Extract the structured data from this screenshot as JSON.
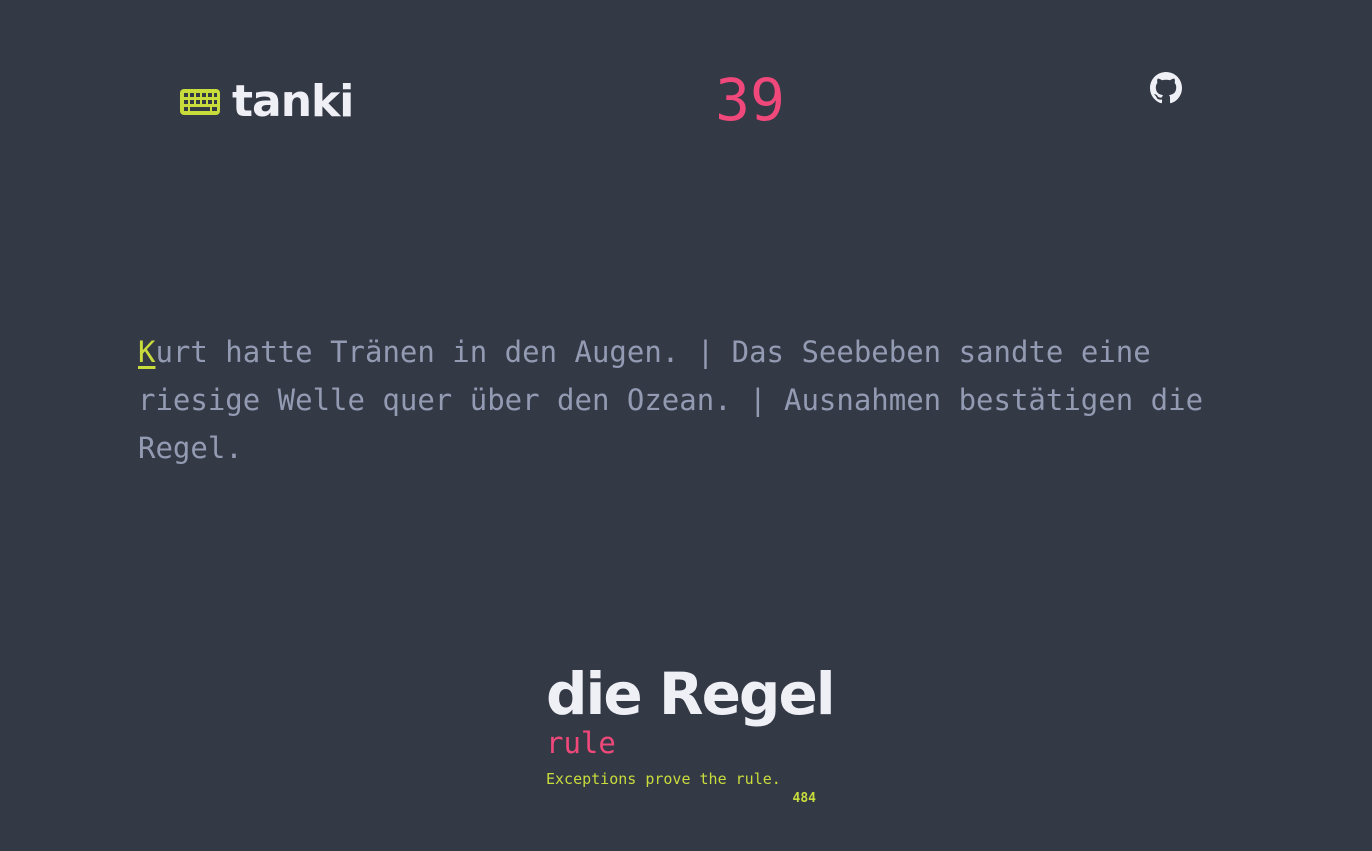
{
  "brand": {
    "name": "tanki",
    "icon": "keyboard-icon",
    "icon_color": "#c8dc3c"
  },
  "counter": {
    "value": "39",
    "color": "#f0487a"
  },
  "header": {
    "github_icon": "github-icon"
  },
  "typing": {
    "current_char": "K",
    "remaining_text": "urt hatte Tränen in den Augen. | Das Seebeben sandte eine riesige Welle quer über den Ozean. | Ausnahmen bestätigen die Regel."
  },
  "card": {
    "term": "die Regel",
    "translation": "rule",
    "example": "Exceptions prove the rule.",
    "rank": "484"
  },
  "colors": {
    "background": "#343946",
    "accent_yellow": "#c8dc3c",
    "accent_pink": "#f0487a",
    "text_muted": "#939bb3"
  }
}
